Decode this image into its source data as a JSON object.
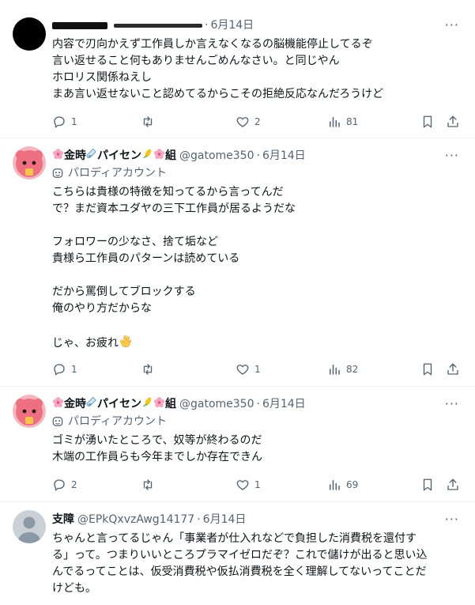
{
  "tweets": [
    {
      "display_name": "",
      "handle": "",
      "date": "6月14日",
      "parody_label": "",
      "lines": [
        "内容で刃向かえず工作員しか言えなくなるの脳機能停止してるぞ",
        "言い返せること何もありませんごめんなさい。と同じやん",
        "ホロリス関係ねえし",
        "まあ言い返せないこと認めてるからこその拒絶反応なんだろうけど"
      ],
      "reply_count": "1",
      "retweet_count": "",
      "like_count": "2",
      "view_count": "81"
    },
    {
      "display_name_parts": [
        "金時",
        "パイセン",
        "組"
      ],
      "handle": "@gatome350",
      "date": "6月14日",
      "parody_label": "パロディアカウント",
      "lines": [
        "こちらは貴様の特徴を知ってるから言ってんだ",
        "で？まだ資本ユダヤの三下工作員が居るようだな",
        "",
        "フォロワーの少なさ、捨て垢など",
        "貴様ら工作員のパターンは読めている",
        "",
        "だから罵倒してブロックする",
        "俺のやり方だからな",
        "",
        "じゃ、お疲れ"
      ],
      "reply_count": "1",
      "retweet_count": "",
      "like_count": "1",
      "view_count": "82"
    },
    {
      "display_name_parts": [
        "金時",
        "パイセン",
        "組"
      ],
      "handle": "@gatome350",
      "date": "6月14日",
      "parody_label": "パロディアカウント",
      "lines": [
        "ゴミが湧いたところで、奴等が終わるのだ",
        "木端の工作員らも今年までしか存在できん"
      ],
      "reply_count": "2",
      "retweet_count": "",
      "like_count": "1",
      "view_count": "69"
    },
    {
      "display_name": "支障",
      "handle": "@EPkQxvzAwg14177",
      "date": "6月14日",
      "parody_label": "",
      "lines": [
        "ちゃんと言ってるじゃん「事業者が仕入れなどで負担した消費税を還付す",
        "る」って。つまりいいところプラマイゼロだぞ？これで儲けが出ると思い込",
        "んでるってことは、仮受消費税や仮払消費税を全く理解してないってことだ",
        "けども。"
      ]
    }
  ],
  "date_separator": "·",
  "more_glyph": "···",
  "colors": {
    "text_primary": "#0f1419",
    "text_secondary": "#536471",
    "divider": "#eff3f4",
    "avatar_pink": "#ee6f7f",
    "avatar_gray": "#c9d1d7"
  }
}
